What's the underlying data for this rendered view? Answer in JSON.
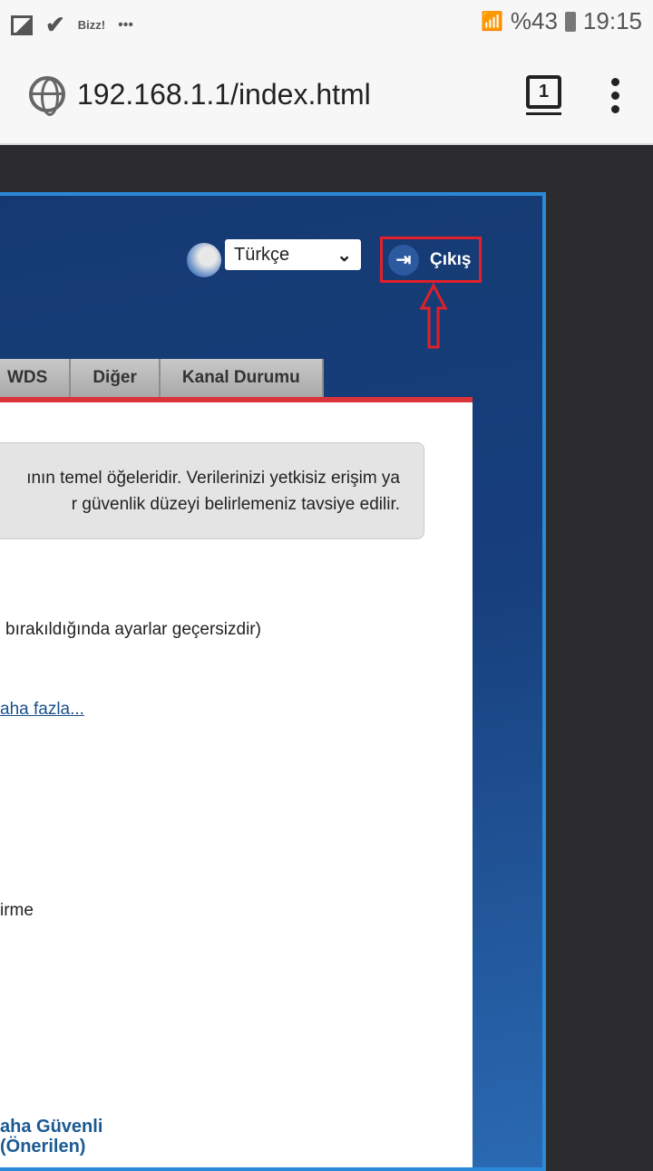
{
  "status_bar": {
    "app_label": "Bizz!",
    "more": "•••",
    "battery": "%43",
    "time": "19:15"
  },
  "browser": {
    "url": "192.168.1.1/index.html",
    "tab_count": "1"
  },
  "header": {
    "language": "Türkçe",
    "logout_label": "Çıkış"
  },
  "nav_tabs": [
    "WDS",
    "Diğer",
    "Kanal Durumu"
  ],
  "content": {
    "info_line1": "ının temel öğeleridir. Verilerinizi yetkisiz erişim ya",
    "info_line2": "r güvenlik düzeyi belirlemeniz tavsiye edilir.",
    "note": "bırakıldığında ayarlar geçersizdir)",
    "more_link": "aha fazla...",
    "option_text": "irme",
    "recommended_line1": "aha Güvenli",
    "recommended_line2": "(Önerilen)"
  }
}
